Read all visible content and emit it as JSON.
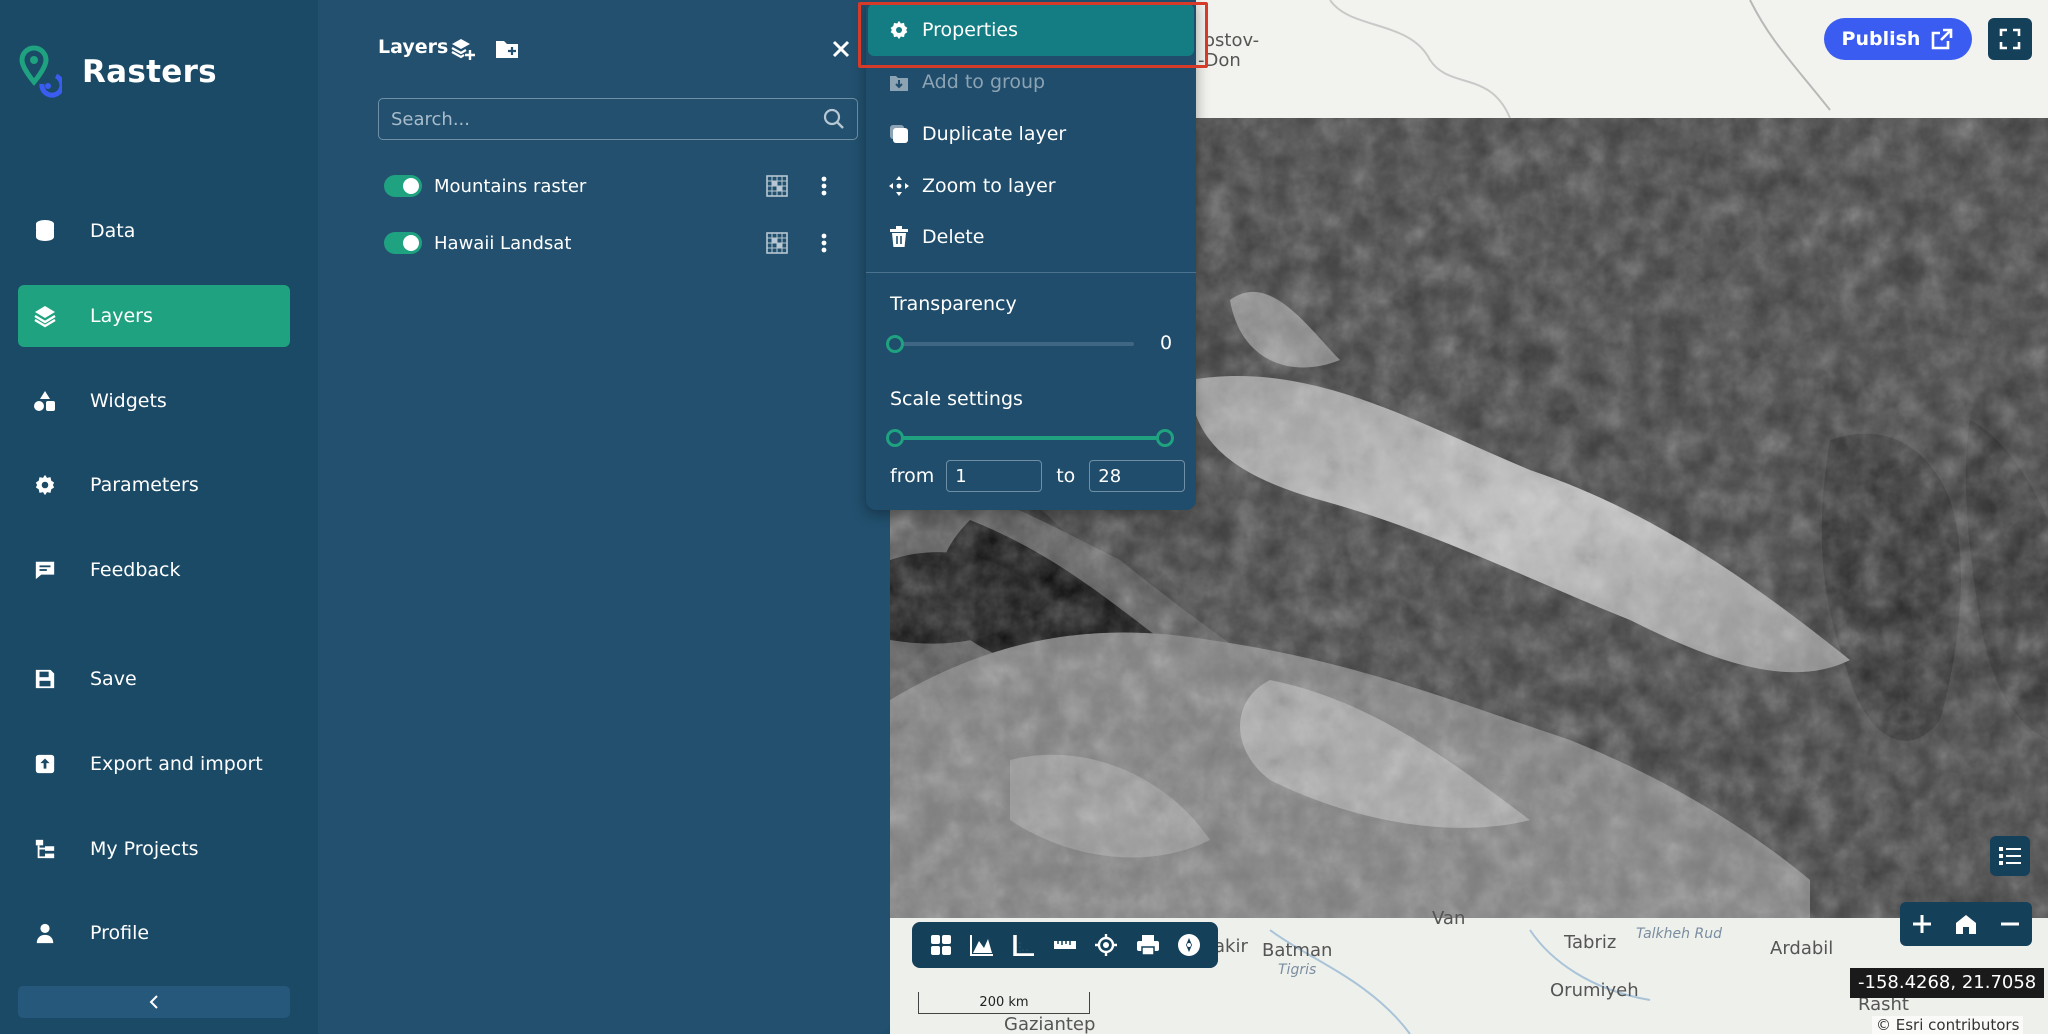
{
  "app": {
    "name": "Rasters"
  },
  "sidebar": {
    "items": [
      {
        "label": "Data",
        "icon": "database-icon"
      },
      {
        "label": "Layers",
        "icon": "layers-icon",
        "active": true
      },
      {
        "label": "Widgets",
        "icon": "widgets-icon"
      },
      {
        "label": "Parameters",
        "icon": "gear-icon"
      },
      {
        "label": "Feedback",
        "icon": "comment-icon"
      },
      {
        "label": "Save",
        "icon": "save-icon"
      },
      {
        "label": "Export and import",
        "icon": "upload-icon"
      },
      {
        "label": "My Projects",
        "icon": "projects-icon"
      },
      {
        "label": "Profile",
        "icon": "user-icon"
      }
    ]
  },
  "layers_panel": {
    "title": "Layers",
    "search_placeholder": "Search...",
    "layers": [
      {
        "name": "Mountains raster",
        "visible": true
      },
      {
        "name": "Hawaii Landsat",
        "visible": true
      }
    ]
  },
  "context_menu": {
    "items": [
      {
        "label": "Properties",
        "icon": "gear-icon",
        "highlighted": true
      },
      {
        "label": "Add to group",
        "icon": "add-to-group-icon",
        "disabled": true
      },
      {
        "label": "Duplicate layer",
        "icon": "duplicate-icon"
      },
      {
        "label": "Zoom to layer",
        "icon": "move-icon"
      },
      {
        "label": "Delete",
        "icon": "trash-icon"
      }
    ],
    "transparency": {
      "label": "Transparency",
      "value": "0"
    },
    "scale_settings": {
      "label": "Scale settings",
      "from_label": "from",
      "to_label": "to",
      "from_value": "1",
      "to_value": "28"
    }
  },
  "map": {
    "publish_label": "Publish",
    "coordinates": "-158.4268, 21.7058",
    "attribution": "© Esri contributors",
    "scalebar_label": "200 km",
    "place_labels": [
      "ostov-",
      "-Don",
      "Van",
      "Batman",
      "Tabriz",
      "Ardabil",
      "Orumiyeh",
      "Rasht",
      "Gaziantep",
      "akir"
    ],
    "river_labels": [
      "Tigris",
      "Talkheh Rud"
    ],
    "toolbar_icons": [
      "grid-icon",
      "chart-icon",
      "ruler-angle-icon",
      "measure-icon",
      "locate-icon",
      "print-icon",
      "compass-icon"
    ]
  }
}
